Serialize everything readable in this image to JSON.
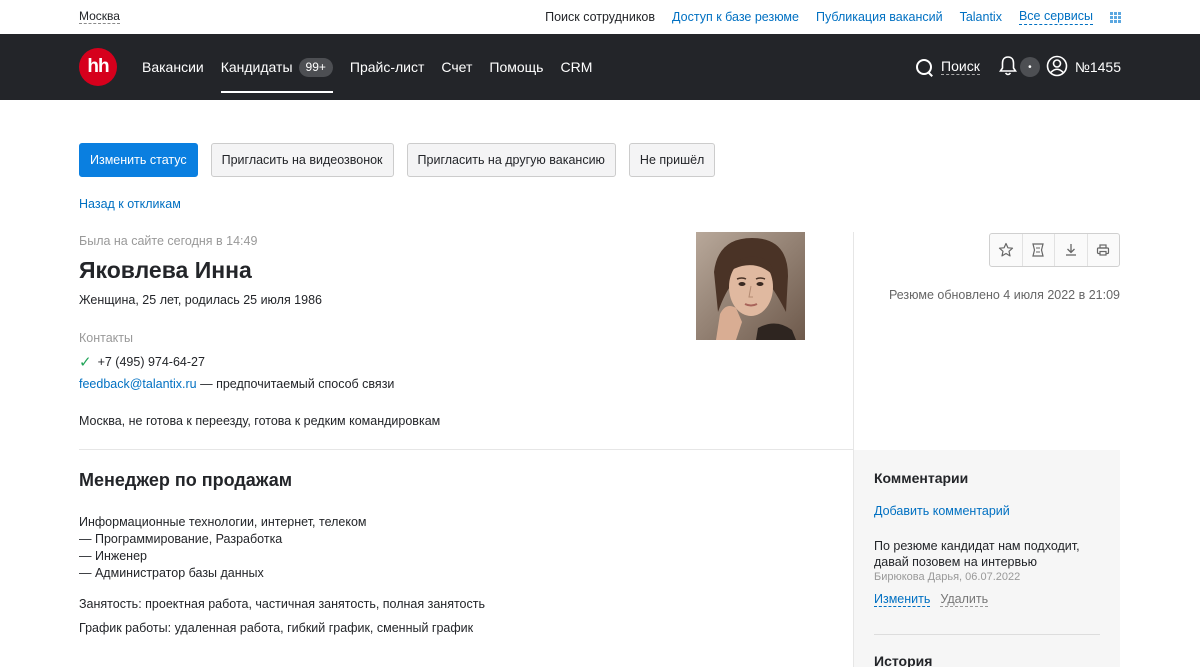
{
  "topbar": {
    "city": "Москва",
    "links": [
      {
        "label": "Поиск сотрудников"
      },
      {
        "label": "Доступ к базе резюме"
      },
      {
        "label": "Публикация вакансий"
      },
      {
        "label": "Talantix"
      },
      {
        "label": "Все сервисы"
      }
    ]
  },
  "nav": {
    "logo": "hh",
    "items": [
      {
        "label": "Вакансии"
      },
      {
        "label": "Кандидаты",
        "badge": "99+"
      },
      {
        "label": "Прайс-лист"
      },
      {
        "label": "Счет"
      },
      {
        "label": "Помощь"
      },
      {
        "label": "CRM"
      }
    ],
    "search_label": "Поиск",
    "notif_badge": "•",
    "account": "№1455",
    "icons": [
      "search-icon",
      "bell-icon",
      "user-icon"
    ]
  },
  "actions": {
    "change_status": "Изменить статус",
    "invite_video": "Пригласить на видеозвонок",
    "invite_other": "Пригласить на другую вакансию",
    "no_show": "Не пришёл"
  },
  "back_link": "Назад к откликам",
  "candidate": {
    "last_seen": "Была на сайте сегодня в 14:49",
    "name": "Яковлева Инна",
    "meta": "Женщина, 25 лет, родилась 25 июля 1986",
    "contacts_heading": "Контакты",
    "phone": "+7 (495) 974-64-27",
    "email": "feedback@talantix.ru",
    "email_note": " — предпочитаемый способ связи",
    "location": "Москва, не готова к переезду, готова к редким командировкам"
  },
  "resume": {
    "icons": [
      "star-icon",
      "bookmark-icon",
      "download-icon",
      "print-icon"
    ],
    "updated": "Резюме обновлено 4 июля 2022 в 21:09"
  },
  "position": {
    "title": "Менеджер по продажам",
    "industry": "Информационные технологии, интернет, телеком",
    "specs": [
      "— Программирование, Разработка",
      "— Инженер",
      "— Администратор базы данных"
    ],
    "employment": "Занятость: проектная работа, частичная занятость, полная занятость",
    "schedule": "График работы: удаленная работа, гибкий график, сменный график"
  },
  "comments": {
    "title": "Комментарии",
    "add": "Добавить комментарий",
    "text": "По резюме кандидат нам подходит, давай позовем на интервью",
    "author": "Бирюкова Дарья, 06.07.2022",
    "edit": "Изменить",
    "delete": "Удалить",
    "history_title": "История"
  },
  "colors": {
    "brand_red": "#d6001c",
    "nav_bg": "#232529",
    "primary": "#0a7fe0",
    "link": "#0070c2"
  }
}
